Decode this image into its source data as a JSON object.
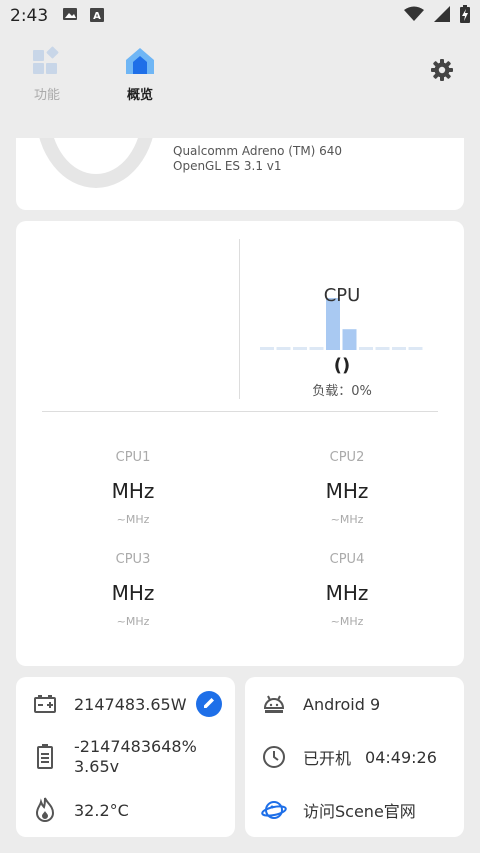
{
  "status_bar": {
    "time": "2:43",
    "icons": [
      "image-icon",
      "a-icon",
      "wifi-icon",
      "signal-icon",
      "battery-charging-icon"
    ]
  },
  "nav": {
    "tabs": [
      {
        "label": "功能",
        "icon": "grid-icon",
        "active": false
      },
      {
        "label": "概览",
        "icon": "home-icon",
        "active": true
      }
    ],
    "settings_icon": "gear-icon"
  },
  "gpu": {
    "renderer": "Qualcomm Adreno (TM) 640",
    "version": "OpenGL ES 3.1 v1"
  },
  "cpu": {
    "title": "CPU",
    "paren": "()",
    "load_label": "负载：0%",
    "bars": [
      0,
      0,
      0,
      0,
      1.0,
      0.4,
      0,
      0,
      0,
      0
    ],
    "cores": [
      {
        "name": "CPU1",
        "freq": "MHz",
        "range": "~MHz"
      },
      {
        "name": "CPU2",
        "freq": "MHz",
        "range": "~MHz"
      },
      {
        "name": "CPU3",
        "freq": "MHz",
        "range": "~MHz"
      },
      {
        "name": "CPU4",
        "freq": "MHz",
        "range": "~MHz"
      }
    ]
  },
  "battery": {
    "power": "2147483.65W",
    "capacity": "-2147483648%",
    "voltage": "3.65v",
    "temperature": "32.2°C"
  },
  "system": {
    "android": "Android 9",
    "uptime_label": "已开机",
    "uptime_value": "04:49:26",
    "website": "访问Scene官网"
  },
  "colors": {
    "accent": "#1e6fe8",
    "bar_active": "#a9c9f2",
    "bar_idle": "#dde8f5"
  }
}
